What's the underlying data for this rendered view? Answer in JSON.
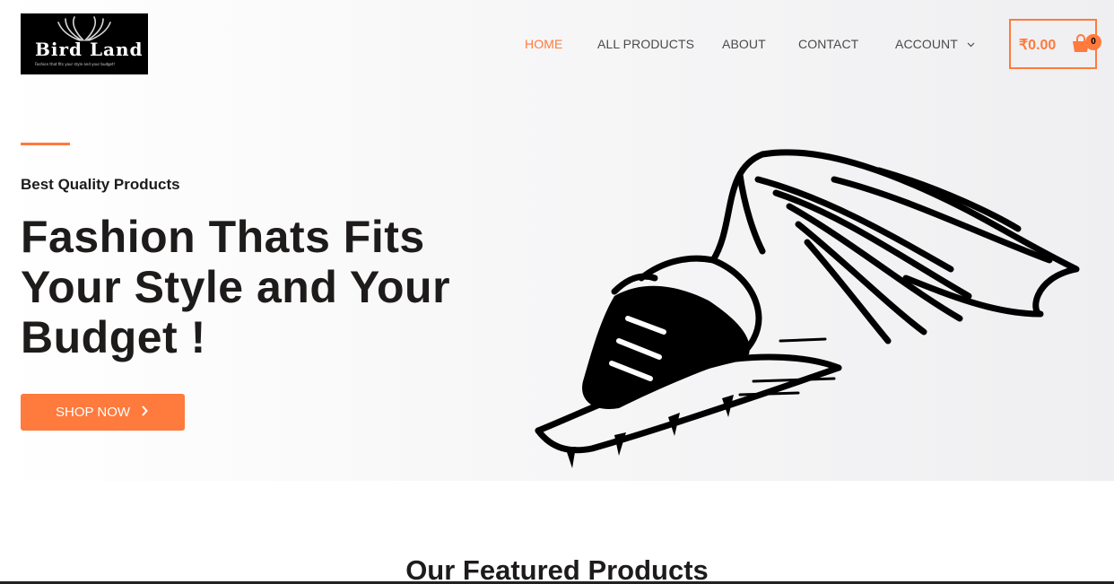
{
  "brand": {
    "logo_text": "Bird Land",
    "tagline": "Fashion that fits your style and your budget!"
  },
  "nav": {
    "items": [
      {
        "label": "HOME",
        "active": true
      },
      {
        "label": "ALL PRODUCTS",
        "active": false
      },
      {
        "label": "ABOUT",
        "active": false
      },
      {
        "label": "CONTACT",
        "active": false
      },
      {
        "label": "ACCOUNT",
        "active": false,
        "has_dropdown": true
      }
    ]
  },
  "cart": {
    "total": "₹0.00",
    "count": "0",
    "icon": "shopping-bag-icon"
  },
  "hero": {
    "subhead": "Best Quality Products",
    "headline_lines": [
      "Fashion Thats Fits",
      "Your Style and Your",
      "Budget !"
    ],
    "cta_label": "SHOP NOW",
    "cta_icon": "chevron-right-icon",
    "image": "winged-sneaker-illustration"
  },
  "featured": {
    "title": "Our Featured Products"
  },
  "colors": {
    "accent": "#ff7a3d",
    "text": "#1e1b1b",
    "nav_text": "#4a4a4a"
  }
}
